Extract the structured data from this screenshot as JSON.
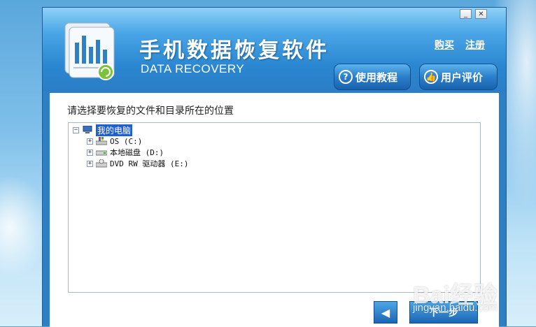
{
  "window": {
    "minimize_label": "_",
    "close_label": "✕"
  },
  "header": {
    "title": "手机数据恢复软件",
    "subtitle": "DATA RECOVERY",
    "links": {
      "buy": "购买",
      "register": "注册"
    },
    "buttons": {
      "help": "使用教程",
      "review": "用户评价"
    },
    "icons": {
      "help": "question-circle-icon",
      "review": "thumbs-up-icon"
    }
  },
  "main": {
    "prompt": "请选择要恢复的文件和目录所在的位置",
    "tree": {
      "root": {
        "label": "我的电脑",
        "expander": "−",
        "icon": "computer-icon"
      },
      "children": [
        {
          "label": "OS (C:)",
          "expander": "+",
          "icon": "windows-drive-icon"
        },
        {
          "label": "本地磁盘 (D:)",
          "expander": "+",
          "icon": "hard-drive-icon"
        },
        {
          "label": "DVD RW 驱动器 (E:)",
          "expander": "+",
          "icon": "dvd-drive-icon"
        }
      ]
    },
    "nav": {
      "back_symbol": "◀",
      "next_label": "下一步"
    }
  },
  "watermark": {
    "brand": "Bai经验",
    "url": "jingyan.baidu.com"
  },
  "colors": {
    "accent": "#2b7fcb",
    "selection": "#1f5fcf",
    "window": "#2f7fc4"
  }
}
